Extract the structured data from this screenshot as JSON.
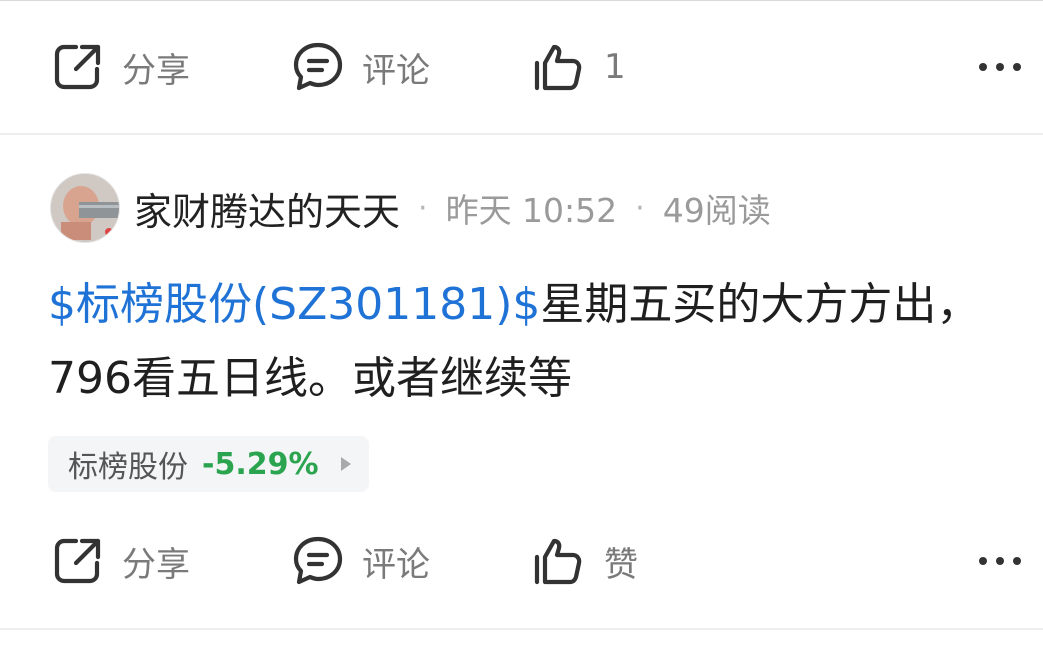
{
  "actions_top": {
    "share_label": "分享",
    "comment_label": "评论",
    "like_label": "1"
  },
  "post": {
    "author": "家财腾达的天天",
    "time": "昨天 10:52",
    "reads": "49阅读",
    "stock_tag": "$标榜股份(SZ301181)$",
    "text": "星期五买的大方方出，796看五日线。或者继续等",
    "stock_chip": {
      "name": "标榜股份",
      "change": "-5.29%",
      "change_color": "#2aa44f"
    }
  },
  "actions_bottom": {
    "share_label": "分享",
    "comment_label": "评论",
    "like_label": "赞"
  },
  "colors": {
    "link": "#1f73d6",
    "muted": "#7a7a7a"
  }
}
